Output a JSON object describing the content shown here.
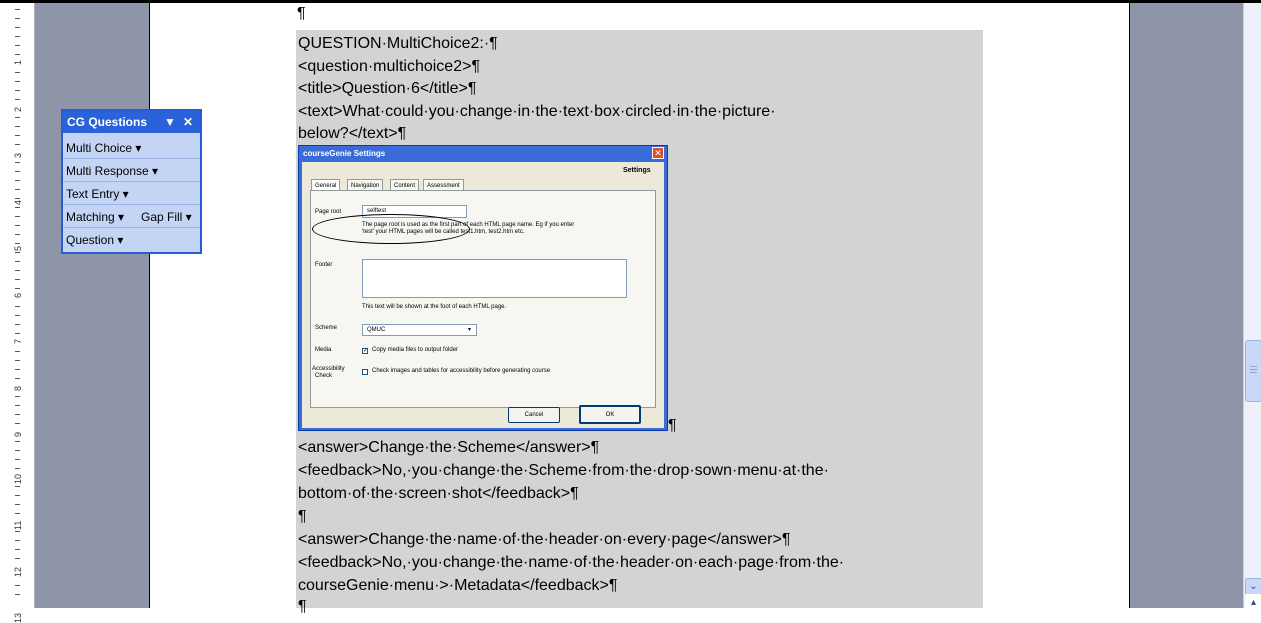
{
  "ruler": {
    "numbers": [
      "1",
      "2",
      "3",
      "4",
      "5",
      "6",
      "7",
      "8",
      "9",
      "10",
      "11",
      "12",
      "13"
    ]
  },
  "doc": {
    "lines": [
      "QUESTION·MultiChoice2:·¶",
      "<question·multichoice2>¶",
      "<title>Question·6</title>¶",
      "<text>What·could·you·change·in·the·text·box·circled·in·the·picture·",
      "below?</text>¶",
      "<answer>Change·the·Scheme</answer>¶",
      "<feedback>No,·you·change·the·Scheme·from·the·drop·sown·menu·at·the·",
      "bottom·of·the·screen·shot</feedback>¶",
      "¶",
      "<answer>Change·the·name·of·the·header·on·every·page</answer>¶",
      "<feedback>No,·you·change·the·name·of·the·header·on·each·page·from·the·",
      "courseGenie·menu·>·Metadata</feedback>¶",
      "¶"
    ],
    "top_pilcrow": "¶",
    "image_pilcrow": "¶"
  },
  "toolbar": {
    "title": "CG Questions",
    "dropdown_glyph": "▼",
    "close_glyph": "✕",
    "items": [
      "Multi Choice ▾",
      "Multi Response ▾",
      "Text Entry ▾",
      "Matching ▾",
      "Gap Fill ▾",
      "Question ▾"
    ]
  },
  "dialog": {
    "title": "courseGenie Settings",
    "close_glyph": "✕",
    "heading": "Settings",
    "tabs": [
      "General",
      "Navigation",
      "Content",
      "Assessment"
    ],
    "page_root_label": "Page root",
    "page_root_value": "selftest",
    "page_root_help_1": "The page root is used as the first part of each HTML page name. Eg if you enter",
    "page_root_help_2": "'test' your HTML pages will be called test1.htm, test2.htm etc.",
    "footer_label": "Footer",
    "footer_help": "This text will be shown at the foot of each HTML page.",
    "scheme_label": "Scheme",
    "scheme_value": "QMUC",
    "media_label": "Media",
    "media_check": "Copy media files to output folder",
    "accessibility_label_1": "Accessibility",
    "accessibility_label_2": "Check",
    "accessibility_check": "Check images and tables for accessibility before generating course",
    "cancel_label": "Cancel",
    "ok_label": "OK"
  },
  "scrollbar": {
    "down_glyph": "⌄",
    "up_glyph": "▴"
  }
}
